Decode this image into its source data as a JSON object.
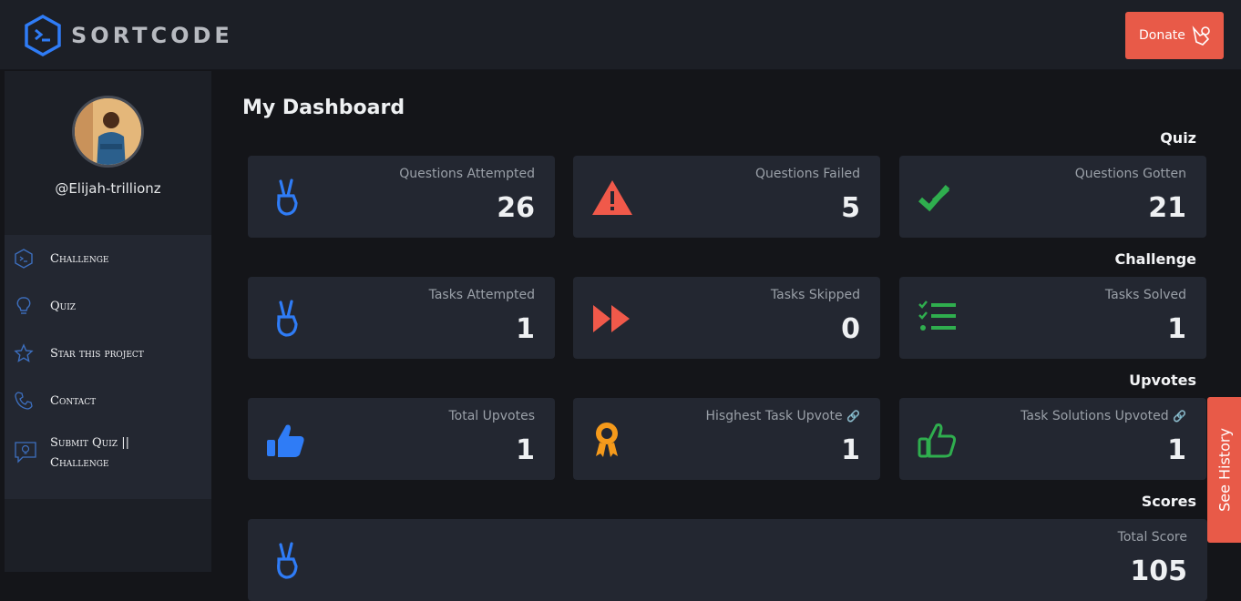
{
  "header": {
    "logo_text": "SORTCODE",
    "donate_label": "Donate"
  },
  "profile": {
    "username": "@Elijah-trillionz"
  },
  "menu": {
    "items": [
      {
        "label": "Challenge",
        "icon": "terminal-icon"
      },
      {
        "label": "Quiz",
        "icon": "lightbulb-icon"
      },
      {
        "label": "Star this project",
        "icon": "star-icon"
      },
      {
        "label": "Contact",
        "icon": "phone-icon"
      },
      {
        "label": "Submit Quiz || Challenge",
        "icon": "comment-idea-icon"
      }
    ]
  },
  "main": {
    "title": "My Dashboard",
    "sections": {
      "quiz": "Quiz",
      "challenge": "Challenge",
      "upvotes": "Upvotes",
      "scores": "Scores"
    },
    "cards": {
      "questions_attempted": {
        "label": "Questions Attempted",
        "value": "26",
        "icon": "peace-hand-icon"
      },
      "questions_failed": {
        "label": "Questions Failed",
        "value": "5",
        "icon": "warning-icon"
      },
      "questions_gotten": {
        "label": "Questions Gotten",
        "value": "21",
        "icon": "double-check-icon"
      },
      "tasks_attempted": {
        "label": "Tasks Attempted",
        "value": "1",
        "icon": "peace-hand-icon"
      },
      "tasks_skipped": {
        "label": "Tasks Skipped",
        "value": "0",
        "icon": "fast-forward-icon"
      },
      "tasks_solved": {
        "label": "Tasks Solved",
        "value": "1",
        "icon": "checklist-icon"
      },
      "total_upvotes": {
        "label": "Total Upvotes",
        "value": "1",
        "icon": "thumbs-up-solid-icon"
      },
      "highest_task_upvote": {
        "label": "Hisghest Task Upvote",
        "value": "1",
        "icon": "award-icon"
      },
      "task_solutions_upvoted": {
        "label": "Task Solutions Upvoted",
        "value": "1",
        "icon": "thumbs-up-outline-icon"
      },
      "total_score": {
        "label": "Total Score",
        "value": "105",
        "icon": "peace-hand-icon"
      }
    }
  },
  "history_label": "See History",
  "colors": {
    "accent": "#e85a48",
    "blue": "#2f7cf6",
    "red": "#f0594a",
    "green": "#2fae4e",
    "orange": "#f59a1b"
  }
}
